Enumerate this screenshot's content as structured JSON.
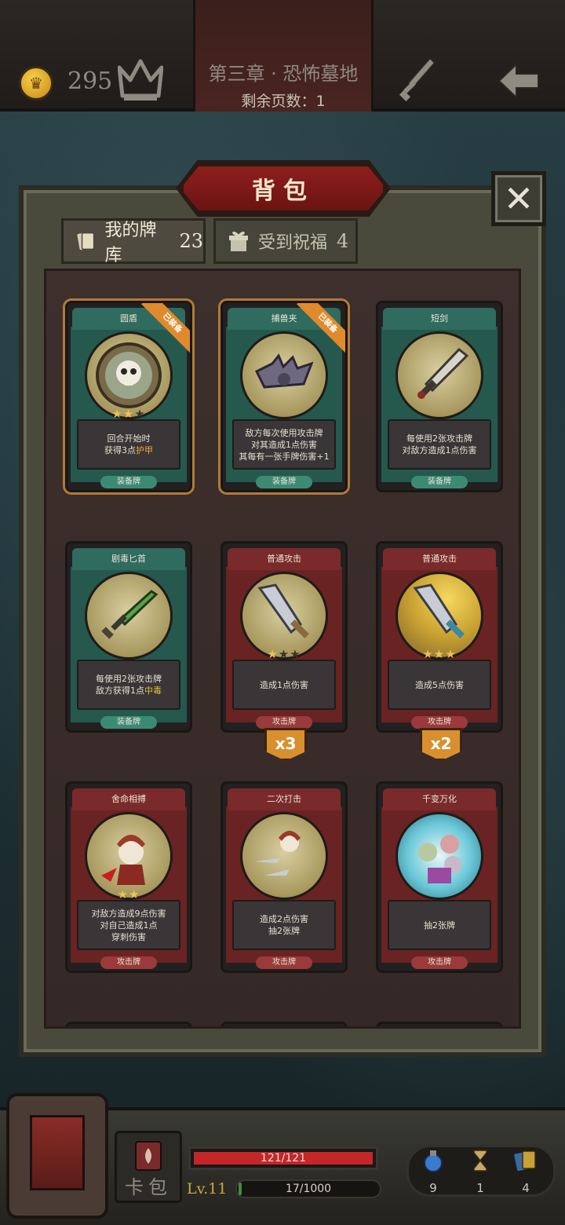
{
  "header": {
    "coins": "295",
    "chapter_title": "第三章 · 恐怖墓地",
    "pages_left": "剩余页数：1"
  },
  "panel": {
    "title": "背包",
    "tabs": [
      {
        "label": "我的牌库",
        "count": "23"
      },
      {
        "label": "受到祝福",
        "count": "4"
      }
    ]
  },
  "cards": [
    {
      "name": "圆盾",
      "type": "装备牌",
      "equipped": true,
      "equipped_label": "已装备",
      "stars": 2,
      "desc": [
        "回合开始时",
        "获得3点护甲"
      ],
      "highlight": "护甲"
    },
    {
      "name": "捕兽夹",
      "type": "装备牌",
      "equipped": true,
      "equipped_label": "已装备",
      "stars": 0,
      "desc": [
        "敌方每次使用攻击牌",
        "对其造成1点伤害",
        "其每有一张手牌伤害+1"
      ]
    },
    {
      "name": "短剑",
      "type": "装备牌",
      "equipped": false,
      "stars": 0,
      "desc": [
        "每使用2张攻击牌",
        "对敌方造成1点伤害"
      ]
    },
    {
      "name": "剧毒匕首",
      "type": "装备牌",
      "equipped": false,
      "stars": 0,
      "desc": [
        "每使用2张攻击牌",
        "敌方获得1点中毒"
      ],
      "highlight": "中毒"
    },
    {
      "name": "普通攻击",
      "type": "攻击牌",
      "equipped": false,
      "stars": 1,
      "desc": [
        "造成1点伤害"
      ],
      "count_badge": "x3"
    },
    {
      "name": "普通攻击",
      "type": "攻击牌",
      "equipped": false,
      "stars": 3,
      "desc": [
        "造成5点伤害"
      ],
      "count_badge": "x2"
    },
    {
      "name": "舍命相搏",
      "type": "攻击牌",
      "equipped": false,
      "stars": 2,
      "desc": [
        "对敌方造成9点伤害",
        "对自己造成1点",
        "穿刺伤害"
      ]
    },
    {
      "name": "二次打击",
      "type": "攻击牌",
      "equipped": false,
      "stars": 0,
      "desc": [
        "造成2点伤害",
        "抽2张牌"
      ]
    },
    {
      "name": "千变万化",
      "type": "攻击牌",
      "equipped": false,
      "stars": 0,
      "desc": [
        "抽2张牌"
      ]
    }
  ],
  "bottom": {
    "cardpack_label": "卡包",
    "hp_text": "121/121",
    "hp_fraction": 1.0,
    "level": "Lv.11",
    "xp_text": "17/1000",
    "xp_fraction": 0.017,
    "resources": [
      {
        "icon": "potion-icon",
        "value": "9"
      },
      {
        "icon": "hourglass-icon",
        "value": "1"
      },
      {
        "icon": "cards-icon",
        "value": "4"
      }
    ]
  },
  "colors": {
    "teal_card": "#2f6b5e",
    "red_card": "#7a2a2a",
    "accent_gold": "#e8c35a",
    "equipped_orange": "#e08a2c"
  }
}
